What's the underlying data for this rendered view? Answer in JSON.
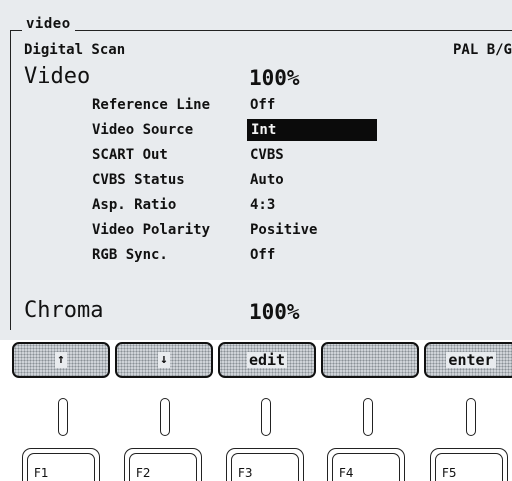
{
  "menu": {
    "title": "video"
  },
  "header": {
    "left": "Digital Scan",
    "right": "PAL B/G"
  },
  "video": {
    "label": "Video",
    "level": "100%"
  },
  "settings": [
    {
      "label": "Reference Line",
      "value": "Off",
      "selected": false
    },
    {
      "label": "Video Source",
      "value": "Int",
      "selected": true
    },
    {
      "label": "SCART Out",
      "value": "CVBS",
      "selected": false
    },
    {
      "label": "CVBS Status",
      "value": "Auto",
      "selected": false
    },
    {
      "label": "Asp. Ratio",
      "value": "4:3",
      "selected": false
    },
    {
      "label": "Video Polarity",
      "value": "Positive",
      "selected": false
    },
    {
      "label": "RGB Sync.",
      "value": "Off",
      "selected": false
    }
  ],
  "chroma": {
    "label": "Chroma",
    "level": "100%"
  },
  "softkeys": [
    {
      "label": "↑",
      "icon": "up-arrow-icon"
    },
    {
      "label": "↓",
      "icon": "down-arrow-icon"
    },
    {
      "label": "edit"
    },
    {
      "label": ""
    },
    {
      "label": "enter"
    }
  ],
  "function_keys": [
    "F1",
    "F2",
    "F3",
    "F4",
    "F5"
  ],
  "colors": {
    "screen": "#e8ebee",
    "selection": "#0b0b0b",
    "ink": "#111111"
  }
}
